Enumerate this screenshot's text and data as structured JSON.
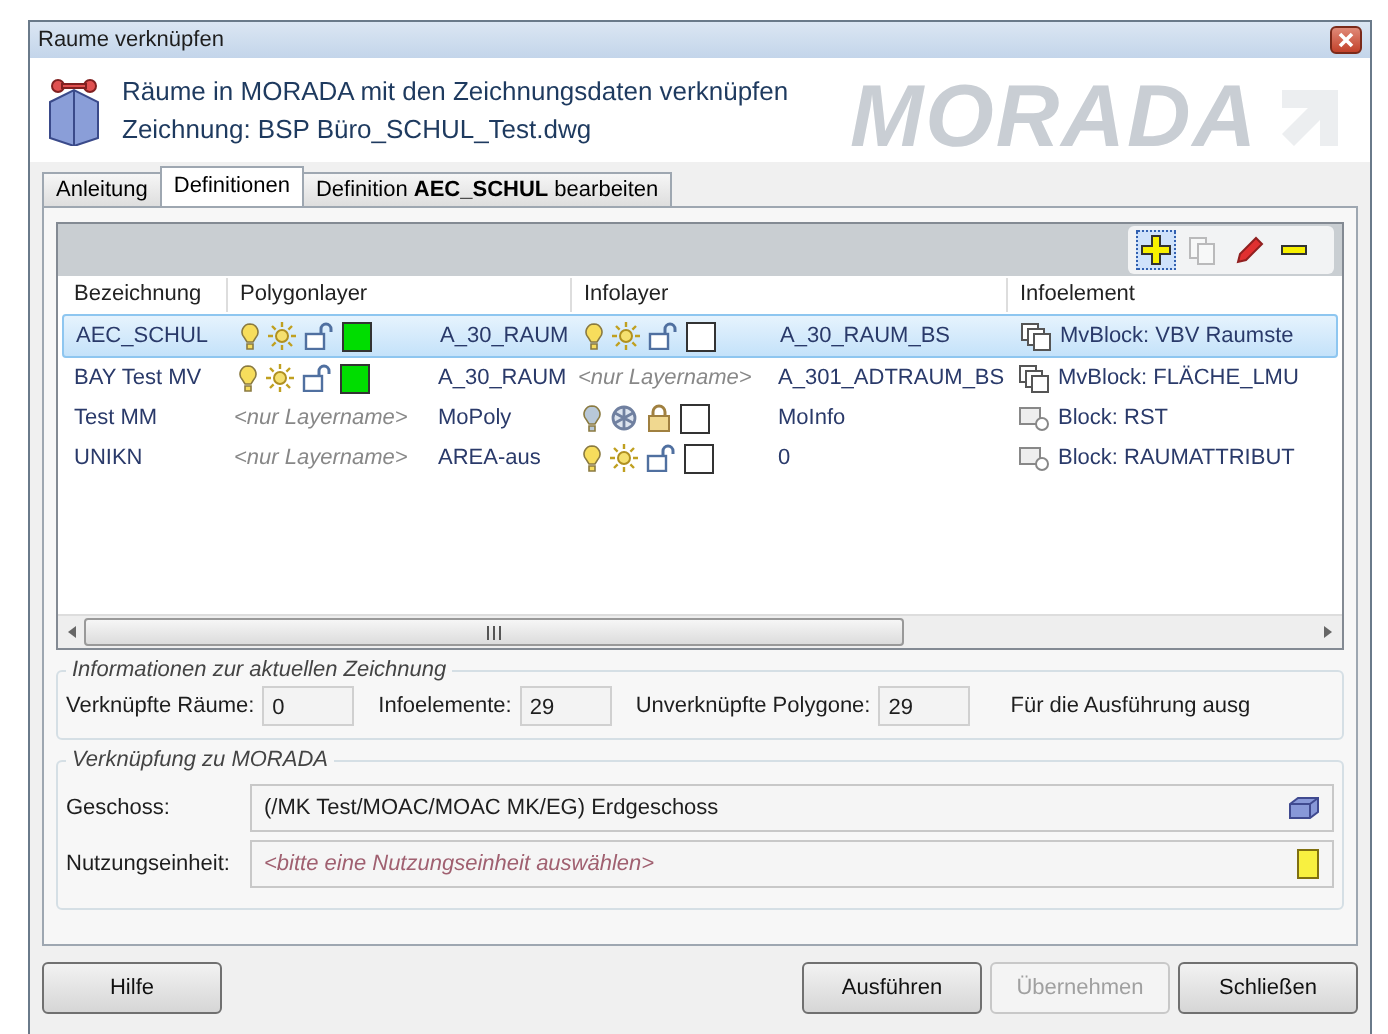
{
  "window": {
    "title": "Raume verknüpfen"
  },
  "header": {
    "title": "Räume in MORADA mit den Zeichnungsdaten verknüpfen",
    "subtitle": "Zeichnung: BSP Büro_SCHUL_Test.dwg",
    "logo": "MORADA"
  },
  "tabs": [
    {
      "label": "Anleitung",
      "selected": false
    },
    {
      "label": "Definitionen",
      "selected": true
    },
    {
      "label": "Definition **AEC_SCHUL** bearbeiten",
      "selected": false
    }
  ],
  "toolbar": [
    {
      "kind": "add",
      "selected": true,
      "disabled": false
    },
    {
      "kind": "copy",
      "selected": false,
      "disabled": true
    },
    {
      "kind": "edit",
      "selected": false,
      "disabled": false
    },
    {
      "kind": "remove",
      "selected": false,
      "disabled": false
    }
  ],
  "table": {
    "columns": [
      "Bezeichnung",
      "Polygonlayer",
      "Infolayer",
      "Infoelement"
    ],
    "rows": [
      {
        "name": "AEC_SCHUL",
        "selected": true,
        "polygon_layer": {
          "kind": "icons",
          "on": true,
          "frozen": false,
          "locked": false,
          "color": "#00dd00"
        },
        "polygon_layer_name": "A_30_RAUM",
        "info_layer": {
          "kind": "icons",
          "on": true,
          "frozen": false,
          "locked": false,
          "color": "#ffffff"
        },
        "info_layer_name": "A_30_RAUM_BS",
        "info_element": {
          "kind": "mvblock",
          "text": "MvBlock: VBV Raumste"
        }
      },
      {
        "name": "BAY Test MV",
        "selected": false,
        "polygon_layer": {
          "kind": "icons",
          "on": true,
          "frozen": false,
          "locked": false,
          "color": "#00dd00"
        },
        "polygon_layer_name": "A_30_RAUM",
        "info_layer": {
          "kind": "name_only",
          "label": "<nur Layername>"
        },
        "info_layer_name": "A_301_ADTRAUM_BS",
        "info_element": {
          "kind": "mvblock",
          "text": "MvBlock: FLÄCHE_LMU"
        }
      },
      {
        "name": "Test MM",
        "selected": false,
        "polygon_layer": {
          "kind": "name_only",
          "label": "<nur Layername>"
        },
        "polygon_layer_name": "MoPoly",
        "info_layer": {
          "kind": "icons",
          "on": false,
          "frozen": true,
          "locked": true,
          "color": "#ffffff"
        },
        "info_layer_name": "MoInfo",
        "info_element": {
          "kind": "block",
          "text": "Block: RST"
        }
      },
      {
        "name": "UNIKN",
        "selected": false,
        "polygon_layer": {
          "kind": "name_only",
          "label": "<nur Layername>"
        },
        "polygon_layer_name": "AREA-aus",
        "info_layer": {
          "kind": "icons",
          "on": true,
          "frozen": false,
          "locked": false,
          "color": "#ffffff"
        },
        "info_layer_name": "0",
        "info_element": {
          "kind": "block",
          "text": "Block: RAUMATTRIBUT"
        }
      }
    ]
  },
  "info_group": {
    "title": "Informationen zur aktuellen Zeichnung",
    "fields": [
      {
        "label": "Verknüpfte Räume:",
        "value": "0"
      },
      {
        "label": "Infoelemente:",
        "value": "29"
      },
      {
        "label": "Unverknüpfte Polygone:",
        "value": "29"
      }
    ],
    "note": "Für die Ausführung ausg"
  },
  "link_group": {
    "title": "Verknüpfung zu MORADA",
    "fields": [
      {
        "label": "Geschoss:",
        "value": "(/MK Test/MOAC/MOAC MK/EG) Erdgeschoss",
        "kind": "floor"
      },
      {
        "label": "Nutzungseinheit:",
        "placeholder": "<bitte eine Nutzungseinheit auswählen>",
        "kind": "unit"
      }
    ]
  },
  "buttons": [
    {
      "label": "Hilfe",
      "disabled": false
    },
    {
      "label": "Ausführen",
      "disabled": false
    },
    {
      "label": "Übernehmen",
      "disabled": true
    },
    {
      "label": "Schließen",
      "disabled": false
    }
  ]
}
